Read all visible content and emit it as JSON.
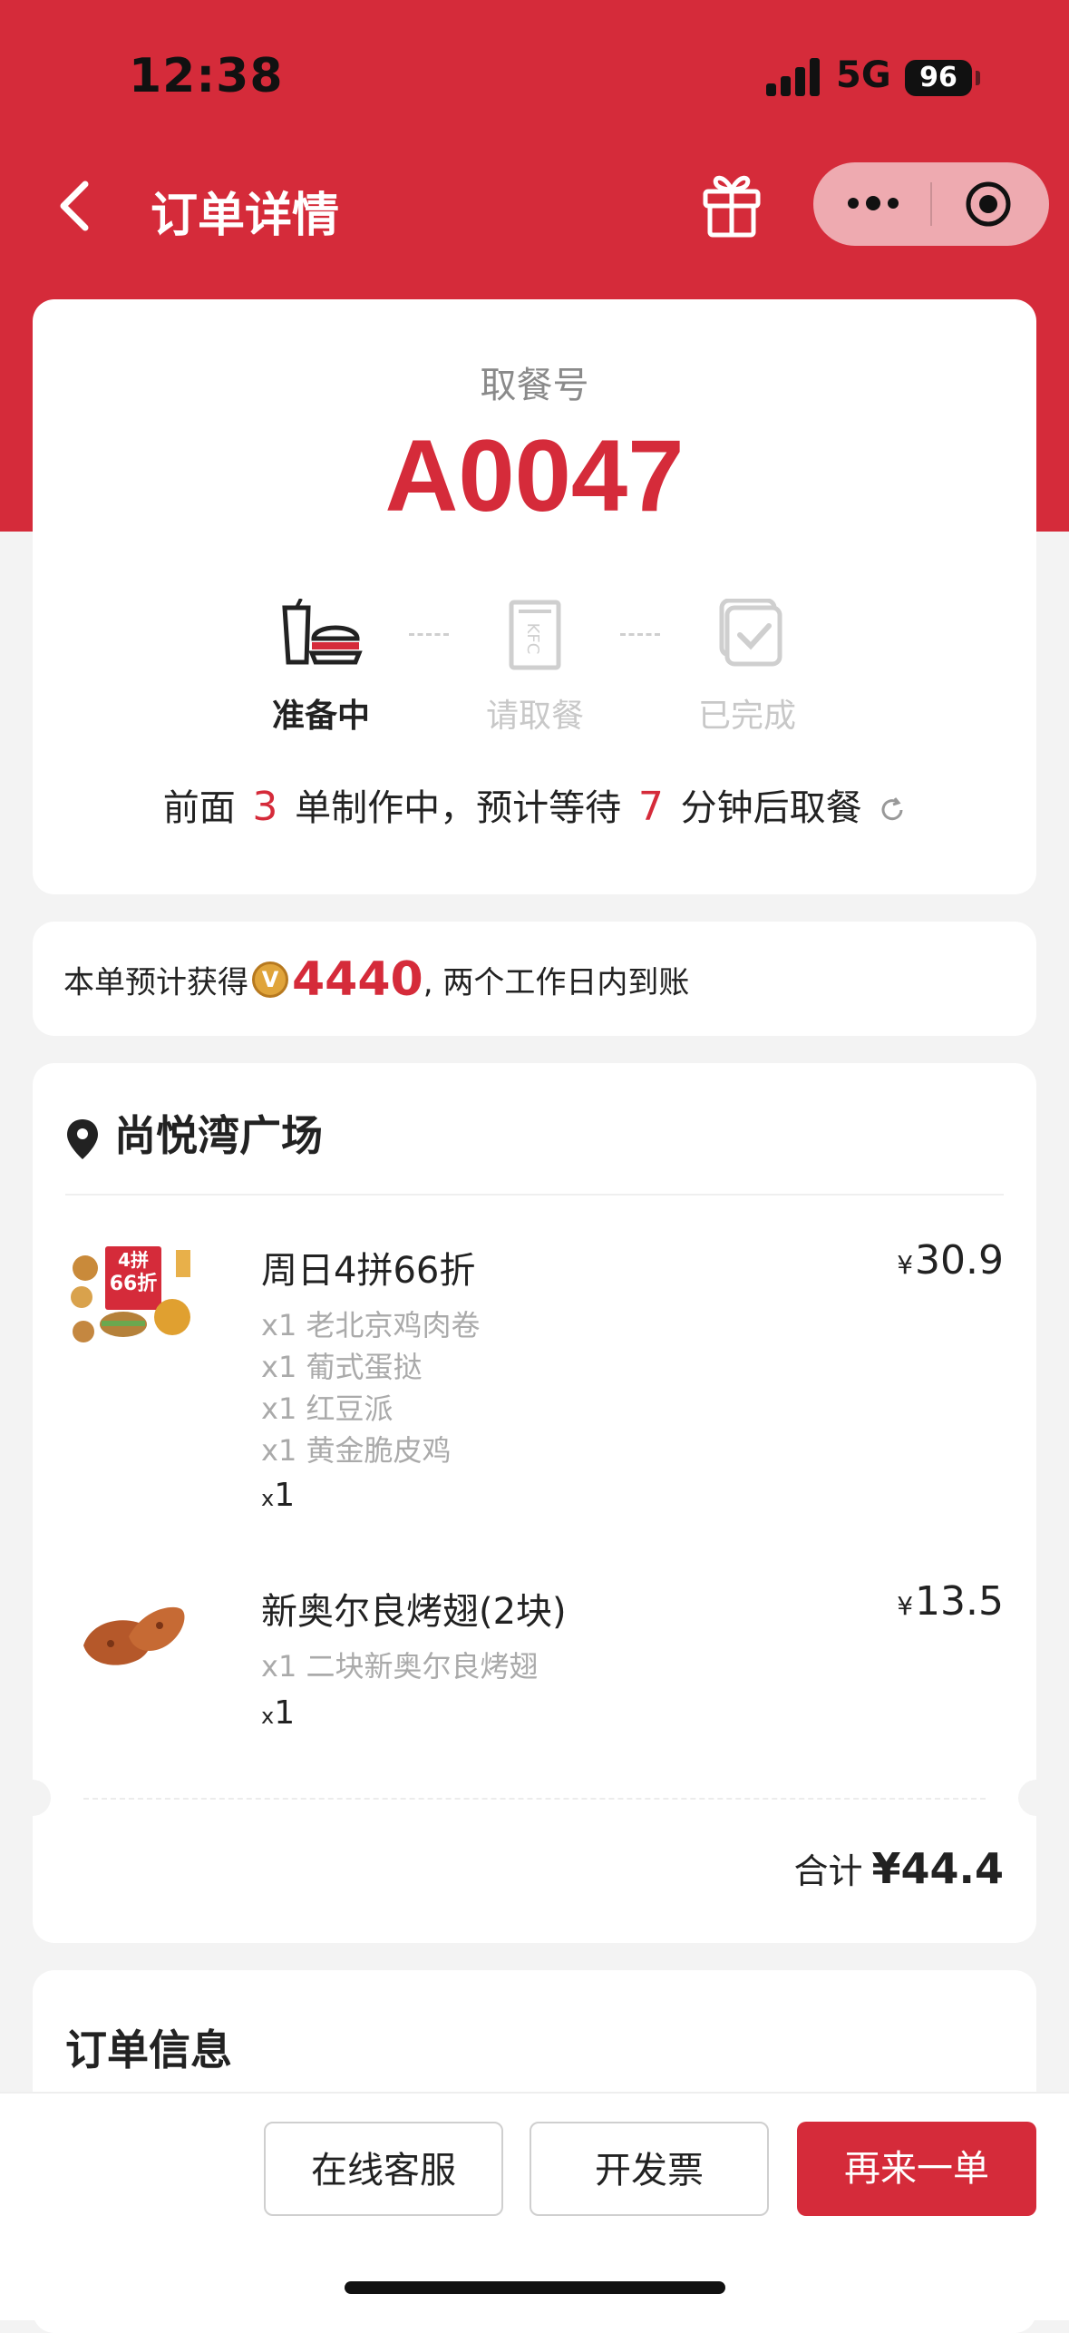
{
  "status_bar": {
    "time": "12:38",
    "network": "5G",
    "battery": "96"
  },
  "nav": {
    "title": "订单详情"
  },
  "pickup": {
    "label": "取餐号",
    "code": "A0047",
    "steps": [
      {
        "label": "准备中",
        "state": "active"
      },
      {
        "label": "请取餐",
        "state": "inactive"
      },
      {
        "label": "已完成",
        "state": "inactive"
      }
    ],
    "wait": {
      "prefix": "前面",
      "orders_ahead": "3",
      "middle": "单制作中，预计等待",
      "minutes": "7",
      "suffix": "分钟后取餐"
    }
  },
  "points": {
    "prefix": "本单预计获得",
    "coin_icon": "V",
    "amount": "4440",
    "suffix": ", 两个工作日内到账"
  },
  "store": {
    "name": "尚悦湾广场"
  },
  "items": [
    {
      "name": "周日4拼66折",
      "price_symbol": "¥",
      "price": "30.9",
      "subitems": [
        "x1 老北京鸡肉卷",
        "x1 葡式蛋挞",
        "x1 红豆派",
        "x1 黄金脆皮鸡"
      ],
      "qty_prefix": "x",
      "qty": "1",
      "thumb_text": [
        "4拼",
        "66折"
      ]
    },
    {
      "name": "新奥尔良烤翅(2块)",
      "price_symbol": "¥",
      "price": "13.5",
      "subitems": [
        "x1 二块新奥尔良烤翅"
      ],
      "qty_prefix": "x",
      "qty": "1"
    }
  ],
  "total": {
    "label": "合计",
    "amount": "¥44.4"
  },
  "order_info": {
    "title": "订单信息"
  },
  "actions": {
    "support": "在线客服",
    "invoice": "开发票",
    "reorder": "再来一单"
  },
  "colors": {
    "brand": "#d52b3a",
    "background": "#f3f3f3"
  }
}
